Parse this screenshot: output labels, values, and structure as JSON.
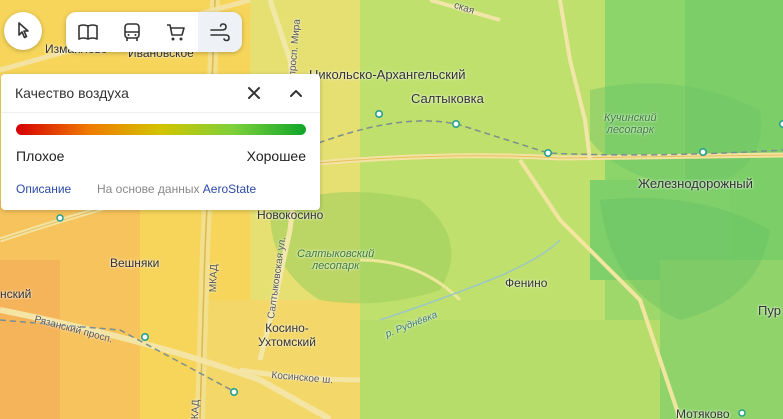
{
  "toolbar": {
    "locate_icon": "cursor-arrow-icon",
    "layers": [
      {
        "name": "map-book-icon",
        "active": false
      },
      {
        "name": "bus-icon",
        "active": false
      },
      {
        "name": "cart-icon",
        "active": false
      },
      {
        "name": "wind-icon",
        "active": true
      }
    ]
  },
  "panel": {
    "title": "Качество воздуха",
    "scale_colors": [
      "#d40000",
      "#f07a00",
      "#d2c400",
      "#7dd03a",
      "#0fa52a"
    ],
    "bad_label": "Плохое",
    "good_label": "Хорошее",
    "description_link": "Описание",
    "source_prefix": "На основе данных",
    "source_name": "AeroState"
  },
  "map": {
    "places": {
      "nikolsko": "Никольско-Архангельский",
      "saltykovka": "Салтыковка",
      "kuchinsky_park": "Кучинский\nлесопарк",
      "zheleznodorozhny": "Железнодорожный",
      "novokosino": "Новокосино",
      "saltykovsky_park": "Салтыковский\nлесопарк",
      "veshnyaki": "Вешняки",
      "fenino": "Фенино",
      "kosino": "Косино-\nУхтомский",
      "motyakovo": "Мотяково",
      "ivanovskoe": "Ивановское",
      "izmaylovo": "Измайлово",
      "kinsky_partial": "нский",
      "pur_partial": "Пур"
    },
    "roads": {
      "mkad": "МКАД",
      "mkad2": "КАД",
      "ryazansky": "Рязанский просп.",
      "kosinskoe": "Косинское ш.",
      "saltykovskaya": "Салтыковская ул.",
      "rudnevka": "р. Руднёвка",
      "mira": "просп. Мира",
      "top_partial": "ская"
    }
  }
}
